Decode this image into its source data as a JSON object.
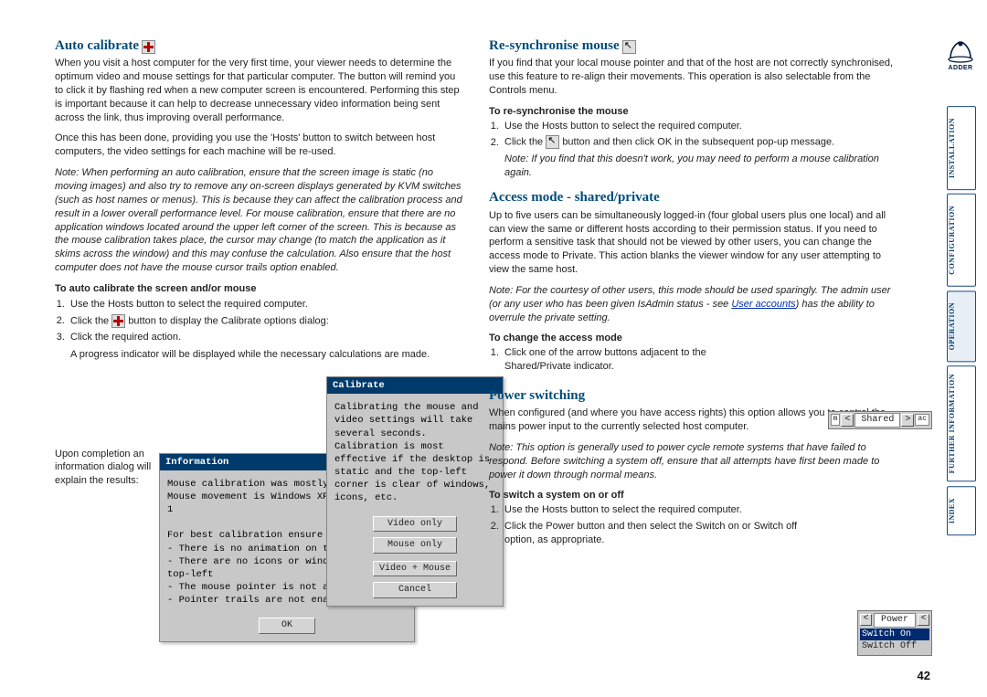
{
  "pageNumber": "42",
  "sidebar": {
    "tabs": [
      "INSTALLATION",
      "CONFIGURATION",
      "OPERATION",
      "FURTHER INFORMATION",
      "INDEX"
    ],
    "logoText": "ADDER"
  },
  "left": {
    "h_auto": "Auto calibrate",
    "p1": "When you visit a host computer for the very first time, your viewer needs to determine the optimum video and mouse settings for that particular computer. The button will remind you to click it by flashing red when a new computer screen is encountered. Performing this step is important because it can help to decrease unnecessary video information being sent across the link, thus improving overall performance.",
    "p2": "Once this has been done, providing you use the 'Hosts' button to switch between host computers, the video settings for each machine will be re-used.",
    "note": "Note: When performing an auto calibration, ensure that the screen image is static (no moving images) and also try to remove any on-screen displays generated by KVM switches (such as host names or menus). This is because they can affect the calibration process and result in a lower overall performance level. For mouse calibration, ensure that there are no application windows located around the upper left corner of the screen. This is because as the mouse calibration takes place, the cursor may change (to match the application as it skims across the window) and this may confuse the calculation. Also ensure that the host computer does not have the mouse cursor trails option enabled.",
    "sub_auto": "To auto calibrate the screen and/or mouse",
    "s1": "Use the Hosts button to select the required computer.",
    "s2a": "Click the ",
    "s2b": " button to display the Calibrate options dialog:",
    "s3": "Click the required action.",
    "s3b": "A progress indicator will be displayed while the necessary calculations are made.",
    "aside": "Upon completion an information dialog will explain the results:",
    "calibDialog": {
      "title": "Calibrate",
      "body": "Calibrating the mouse and video settings will take several seconds. Calibration is most effective if the desktop is static and the top-left corner is clear of windows, icons, etc.",
      "btns": [
        "Video only",
        "Mouse only",
        "Video + Mouse",
        "Cancel"
      ]
    },
    "infoDialog": {
      "title": "Information",
      "l1": "Mouse calibration was mostly successful.",
      "l2": "Mouse movement is Windows XP Enhanced Mk 1",
      "l3": "For best calibration ensure that:",
      "l4": "- There is no animation on the screen",
      "l5": "- There are no icons or windows at the top-left",
      "l6": "- The mouse pointer is not animated",
      "l7": "- Pointer trails are not enabled",
      "ok": "OK"
    }
  },
  "right": {
    "h_resync": "Re-synchronise mouse",
    "rp1": "If you find that your local mouse pointer and that of the host are not correctly synchronised, use this feature to re-align their movements. This operation is also selectable from the Controls menu.",
    "sub_resync": "To re-synchronise the mouse",
    "r1": "Use the Hosts button to select the required computer.",
    "r2a": "Click the ",
    "r2b": " button and then click OK in the subsequent pop-up message.",
    "rnote": "Note: If you find that this doesn't work, you may need to perform a mouse calibration again.",
    "h_access": "Access mode - shared/private",
    "ap1a": "Up to five users can be simultaneously logged-in (four global users plus one local) and all can view the same or different hosts according to their permission status. If you need to perform a sensitive task that should not be viewed by other users, you can change the access mode to Private. This action blanks the viewer window for any user attempting to view the same host.",
    "anote_a": "Note: For the courtesy of other users, this mode should be used sparingly. The admin user (or any user who has been given IsAdmin status - see ",
    "anote_link": "User accounts",
    "anote_b": ") has the ability to overrule the private setting.",
    "sub_access": "To change the access mode",
    "a1": "Click one of the arrow buttons adjacent to the Shared/Private indicator.",
    "shared": {
      "label": "Shared",
      "left": "m",
      "right": "ac"
    },
    "h_power": "Power switching",
    "pp1": "When configured (and where you have access rights) this option allows you to control the mains power input to the currently selected host computer.",
    "pnote": "Note: This option is generally used to power cycle remote systems that have failed to respond. Before switching a system off, ensure that all attempts have first been made to power it down through normal means.",
    "sub_power": "To switch a system on or off",
    "ps1": "Use the Hosts button to select the required computer.",
    "ps2": "Click the Power button and then select the Switch on or Switch off option, as appropriate.",
    "powerMenu": {
      "label": "Power",
      "on": "Switch On",
      "off": "Switch Off"
    }
  }
}
